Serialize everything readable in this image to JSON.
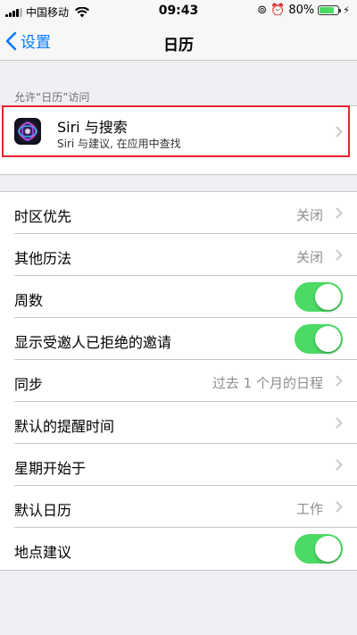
{
  "status_bar": {
    "carrier": "中国移动",
    "time": "09:43",
    "battery": "80%",
    "battery_level": 0.8
  },
  "nav": {
    "back_label": "设置",
    "title": "日历"
  },
  "section_header": "允许“日历”访问",
  "siri": {
    "title": "Siri 与搜索",
    "subtitle": "Siri 与建议, 在应用中查找"
  },
  "settings": {
    "timezone": {
      "label": "时区优先",
      "value": "关闭"
    },
    "alt_calendar": {
      "label": "其他历法",
      "value": "关闭"
    },
    "week_numbers": {
      "label": "周数",
      "on": true
    },
    "declined_events": {
      "label": "显示受邀人已拒绝的邀请",
      "on": true
    },
    "sync": {
      "label": "同步",
      "value": "过去 1 个月的日程"
    },
    "default_alert": {
      "label": "默认的提醒时间"
    },
    "week_start": {
      "label": "星期开始于"
    },
    "default_calendar": {
      "label": "默认日历",
      "value": "工作"
    },
    "location_suggestions": {
      "label": "地点建议",
      "on": true
    }
  },
  "colors": {
    "accent": "#007aff",
    "toggle_on": "#4cd964",
    "highlight": "#e8222b"
  }
}
